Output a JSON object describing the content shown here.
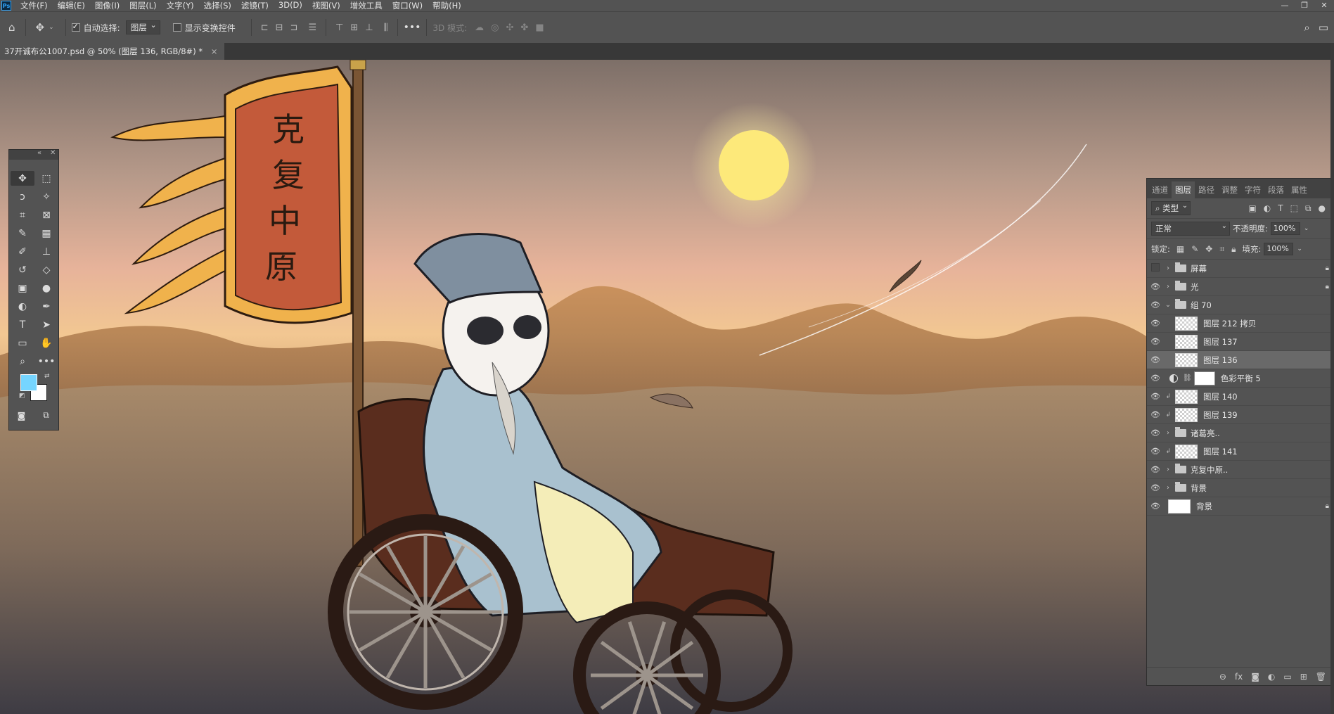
{
  "app": {
    "logo": "Ps"
  },
  "menu": [
    "文件(F)",
    "编辑(E)",
    "图像(I)",
    "图层(L)",
    "文字(Y)",
    "选择(S)",
    "滤镜(T)",
    "3D(D)",
    "视图(V)",
    "增效工具",
    "窗口(W)",
    "帮助(H)"
  ],
  "window_controls": {
    "minimize": "—",
    "restore": "❐",
    "close": "✕"
  },
  "options": {
    "auto_select_label": "自动选择:",
    "auto_select_checked": true,
    "target_value": "图层",
    "show_transform_label": "显示变换控件",
    "more": "•••",
    "mode_3d_label": "3D 模式:"
  },
  "document_tab": {
    "title": "37开诚布公1007.psd @ 50% (图层 136, RGB/8#) *",
    "close": "×"
  },
  "artwork": {
    "banner_chars": [
      "克",
      "复",
      "中",
      "原"
    ]
  },
  "colors": {
    "foreground": "#75d5ff",
    "background": "#ffffff",
    "accent": "#31a8ff"
  },
  "layers_panel": {
    "tabs": [
      "通道",
      "图层",
      "路径",
      "调整",
      "字符",
      "段落",
      "属性"
    ],
    "active_tab": "图层",
    "filter_kind": "类型",
    "blend_mode": "正常",
    "opacity_label": "不透明度:",
    "opacity_value": "100%",
    "lock_label": "锁定:",
    "fill_label": "填充:",
    "fill_value": "100%",
    "layers": [
      {
        "name": "屏幕",
        "type": "group",
        "visible": false,
        "locked": true
      },
      {
        "name": "光",
        "type": "group",
        "visible": true,
        "locked": true
      },
      {
        "name": "组 70",
        "type": "group-open",
        "visible": true
      },
      {
        "name": "图层 212 拷贝",
        "type": "pixel",
        "visible": true,
        "indent": true
      },
      {
        "name": "图层 137",
        "type": "pixel",
        "visible": true,
        "indent": true
      },
      {
        "name": "图层 136",
        "type": "pixel",
        "visible": true,
        "indent": true,
        "selected": true
      },
      {
        "name": "色彩平衡 5",
        "type": "adjustment",
        "visible": true
      },
      {
        "name": "图层 140",
        "type": "pixel",
        "visible": true,
        "clipped": true
      },
      {
        "name": "图层 139",
        "type": "pixel",
        "visible": true,
        "clipped": true
      },
      {
        "name": "诸葛亮..",
        "type": "group",
        "visible": true
      },
      {
        "name": "图层 141",
        "type": "pixel",
        "visible": true,
        "clipped": true
      },
      {
        "name": "克复中原..",
        "type": "group",
        "visible": true
      },
      {
        "name": "背景",
        "type": "group",
        "visible": true
      },
      {
        "name": "背景",
        "type": "background",
        "visible": true,
        "locked": true
      }
    ],
    "footer_icons": [
      "link-icon",
      "fx-icon",
      "mask-icon",
      "adjustment-icon",
      "folder-icon",
      "new-layer-icon",
      "trash-icon"
    ]
  }
}
